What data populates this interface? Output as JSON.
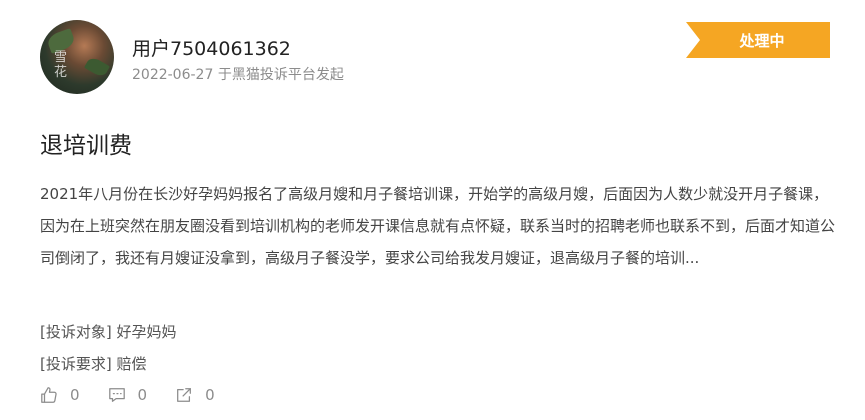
{
  "complaint": {
    "user_name": "用户7504061362",
    "date": "2022-06-27",
    "source": "于黑猫投诉平台发起",
    "status": "处理中",
    "title": "退培训费",
    "content": "2021年八月份在长沙好孕妈妈报名了高级月嫂和月子餐培训课，开始学的高级月嫂，后面因为人数少就没开月子餐课，因为在上班突然在朋友圈没看到培训机构的老师发开课信息就有点怀疑，联系当时的招聘老师也联系不到，后面才知道公司倒闭了，我还有月嫂证没拿到，高级月子餐没学，要求公司给我发月嫂证，退高级月子餐的培训...",
    "target_label": "[投诉对象]",
    "target_value": "好孕妈妈",
    "demand_label": "[投诉要求]",
    "demand_value": "赔偿"
  },
  "avatar": {
    "text": "雪花"
  },
  "actions": {
    "like_count": "0",
    "comment_count": "0",
    "share_count": "0"
  },
  "colors": {
    "status_badge": "#f5a623",
    "meta_text": "#8c8c8c",
    "body_text": "#444444"
  },
  "icons": {
    "like": "thumbs-up-icon",
    "comment": "comment-icon",
    "share": "share-icon"
  }
}
